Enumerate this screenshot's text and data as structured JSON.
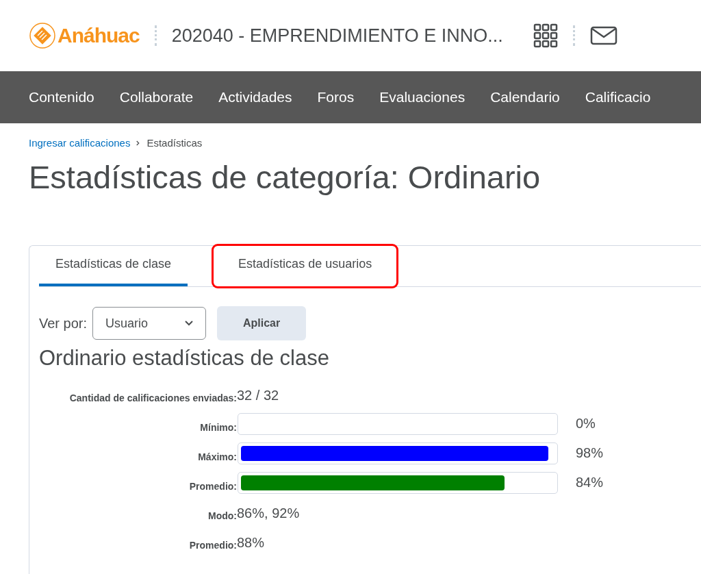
{
  "header": {
    "logo_text": "Anáhuac",
    "course_title": "202040 - EMPRENDIMIENTO E INNO..."
  },
  "nav": [
    "Contenido",
    "Collaborate",
    "Actividades",
    "Foros",
    "Evaluaciones",
    "Calendario",
    "Calificacio"
  ],
  "breadcrumb": {
    "link": "Ingresar calificaciones",
    "current": "Estadísticas"
  },
  "page_title": "Estadísticas de categoría: Ordinario",
  "tabs": [
    {
      "label": "Estadísticas de clase",
      "selected": true,
      "highlighted": false
    },
    {
      "label": "Estadísticas de usuarios",
      "selected": false,
      "highlighted": true
    }
  ],
  "filter": {
    "label": "Ver por:",
    "value": "Usuario",
    "button": "Aplicar"
  },
  "section_title": "Ordinario estadísticas de clase",
  "stats": [
    {
      "kind": "text",
      "label": "Cantidad de calificaciones enviadas:",
      "value": "32 / 32"
    },
    {
      "kind": "bar",
      "label": "Mínimo:",
      "level": 0,
      "reading": "0%"
    },
    {
      "kind": "bar",
      "label": "Máximo:",
      "level": 0.98,
      "color": "#0000ff",
      "reading": "98%"
    },
    {
      "kind": "bar",
      "label": "Promedio:",
      "level": 0.84,
      "color": "#008000",
      "reading": "84%"
    },
    {
      "kind": "text",
      "label": "Modo:",
      "value": "86%, 92%"
    },
    {
      "kind": "text",
      "label": "Promedio:",
      "value": "88%"
    }
  ]
}
